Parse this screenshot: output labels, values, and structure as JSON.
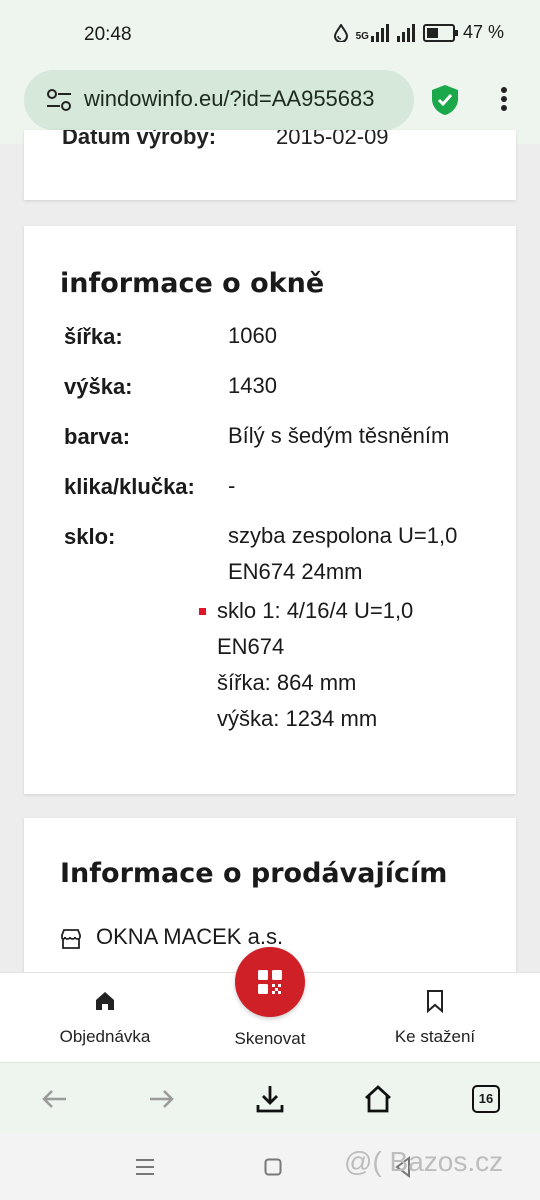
{
  "status": {
    "time": "20:48",
    "network": "5G",
    "battery": "47 %"
  },
  "browser": {
    "url": "windowinfo.eu/?id=AA955683",
    "tab_count": "16"
  },
  "top_card": {
    "cut_label": "Datum výroby:",
    "cut_value": "2015-02-09"
  },
  "window_info": {
    "title": "informace o okně",
    "rows": [
      {
        "label": "šířka:",
        "value": "1060"
      },
      {
        "label": "výška:",
        "value": "1430"
      },
      {
        "label": "barva:",
        "value": "Bílý s šedým těsněním"
      },
      {
        "label": "klika/klučka:",
        "value": "-"
      },
      {
        "label": "sklo:",
        "value": "szyba zespolona U=1,0",
        "value2": "EN674 24mm"
      }
    ],
    "glass_detail": {
      "line1": "sklo 1: 4/16/4 U=1,0",
      "line2": "EN674",
      "line3": "šířka: 864 mm",
      "line4": "výška: 1234 mm"
    }
  },
  "seller": {
    "title": "Informace o prodávajícím",
    "name": "OKNA MACEK a.s."
  },
  "bottom_nav": {
    "order": "Objednávka",
    "scan": "Skenovat",
    "downloads": "Ke stažení"
  },
  "watermark": "@( Bazos.cz",
  "colors": {
    "accent_red": "#cf1f27",
    "bullet_red": "#e0142a",
    "shield_green": "#1aa84a",
    "url_pill": "#d6e8da"
  }
}
